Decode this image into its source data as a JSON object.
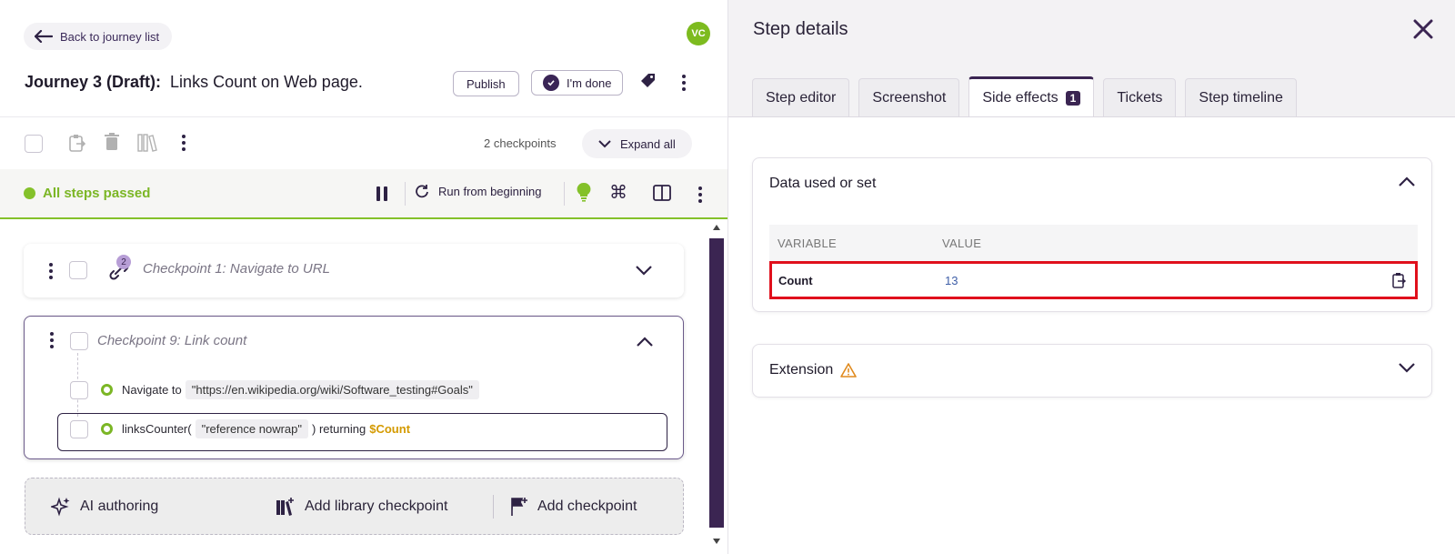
{
  "header": {
    "back_label": "Back to journey list",
    "avatar_initials": "VC",
    "journey_prefix": "Journey 3 (Draft):",
    "journey_name": "Links Count on Web page.",
    "publish_label": "Publish",
    "done_label": "I'm done"
  },
  "toolbar": {
    "checkpoints_count": "2 checkpoints",
    "expand_label": "Expand all"
  },
  "statusbar": {
    "status_text": "All steps passed",
    "run_label": "Run from beginning"
  },
  "checkpoints": [
    {
      "title": "Checkpoint 1:  Navigate to URL",
      "badge": "2"
    },
    {
      "title": "Checkpoint 9:  Link count"
    }
  ],
  "steps": [
    {
      "action": "Navigate to",
      "arg": "\"https://en.wikipedia.org/wiki/Software_testing#Goals\""
    },
    {
      "fn": "linksCounter(",
      "arg": "\"reference nowrap\"",
      "suffix": ") returning",
      "var": "$Count"
    }
  ],
  "add_bar": {
    "ai_label": "AI authoring",
    "library_label": "Add library checkpoint",
    "add_label": "Add checkpoint"
  },
  "panel": {
    "title": "Step details",
    "tabs": [
      {
        "label": "Step editor"
      },
      {
        "label": "Screenshot"
      },
      {
        "label": "Side effects",
        "badge": "1"
      },
      {
        "label": "Tickets"
      },
      {
        "label": "Step timeline"
      }
    ],
    "data_section": {
      "title": "Data used or set",
      "col_variable": "VARIABLE",
      "col_value": "VALUE",
      "rows": [
        {
          "variable": "Count",
          "value": "13"
        }
      ]
    },
    "extension_section": {
      "title": "Extension"
    }
  },
  "colors": {
    "brand": "#3b2552",
    "success": "#84c12a",
    "variable": "#d49a00",
    "highlight": "#e0101c"
  }
}
